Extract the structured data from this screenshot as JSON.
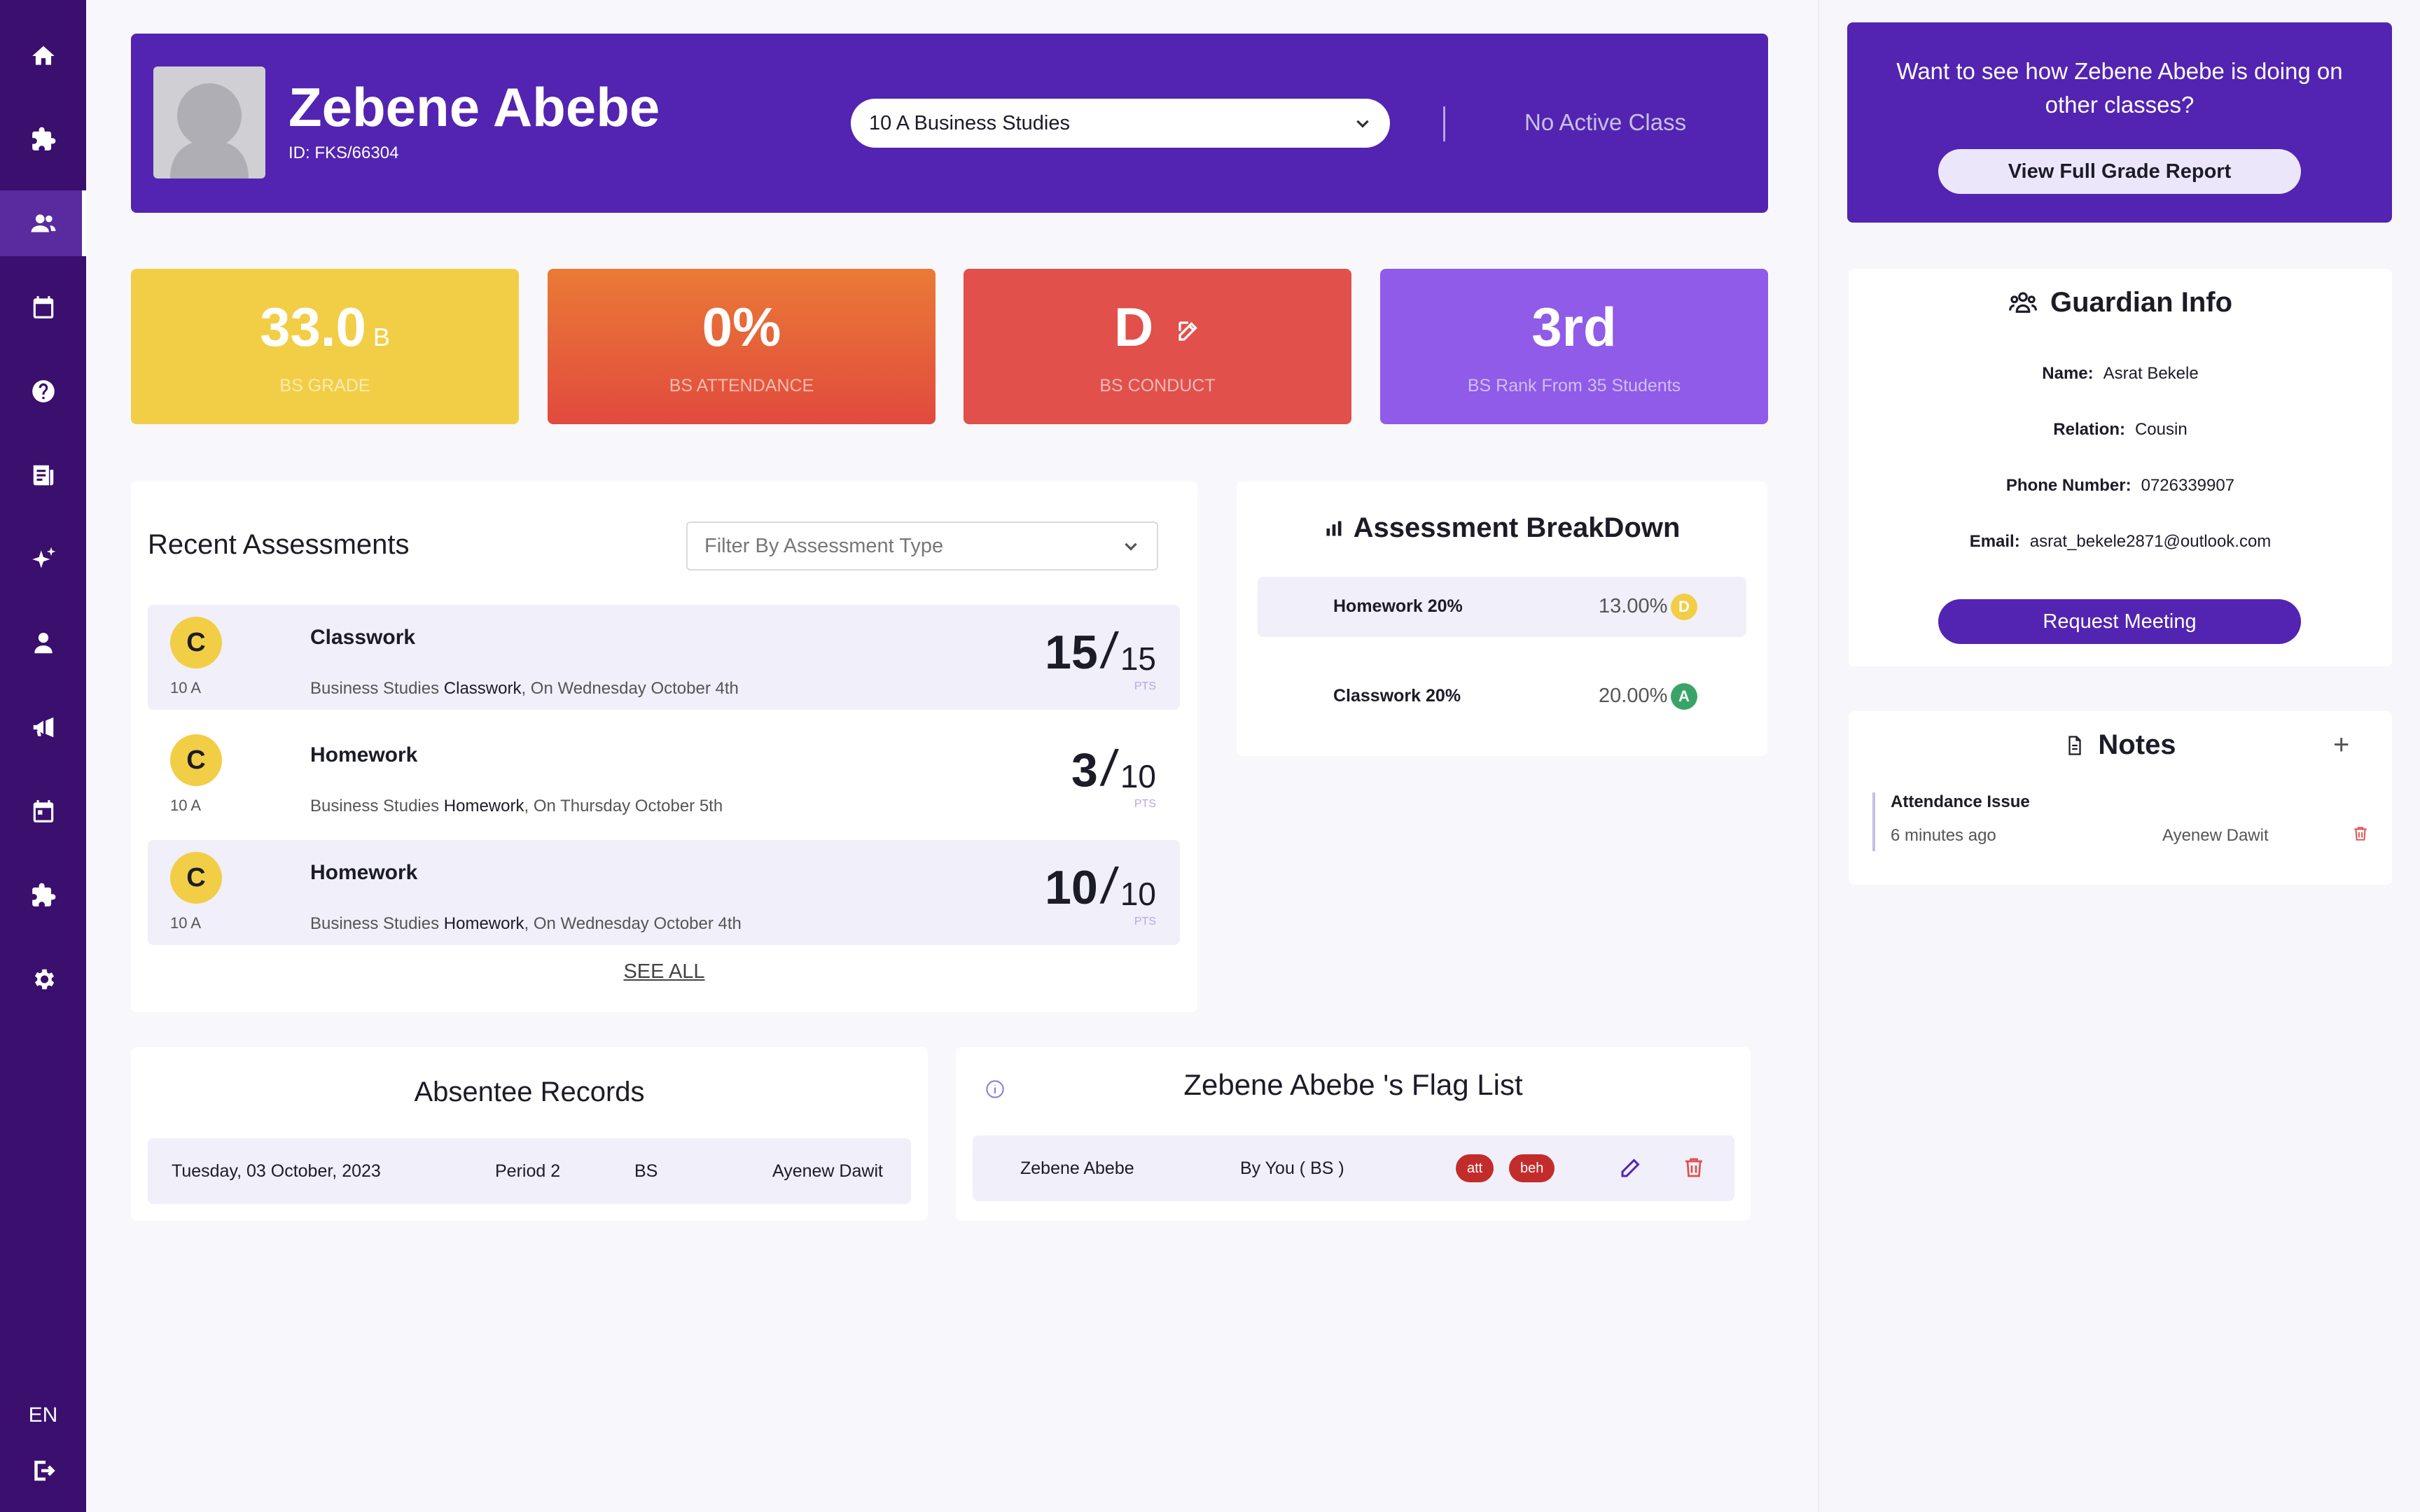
{
  "sidebar": {
    "items": [
      {
        "icon": "home-icon"
      },
      {
        "icon": "puzzle-icon"
      },
      {
        "icon": "users-icon",
        "active": true
      },
      {
        "icon": "calendar-icon"
      },
      {
        "icon": "help-icon"
      },
      {
        "icon": "news-icon"
      },
      {
        "icon": "sparkle-icon"
      },
      {
        "icon": "person-icon"
      },
      {
        "icon": "megaphone-icon"
      },
      {
        "icon": "schedule-icon"
      },
      {
        "icon": "puzzle-icon"
      },
      {
        "icon": "gear-icon"
      }
    ],
    "language": "EN"
  },
  "header": {
    "name": "Zebene Abebe",
    "id": "ID: FKS/66304",
    "class_selected": "10 A Business Studies",
    "no_active_class": "No Active Class"
  },
  "stats": {
    "grade": {
      "value": "33.0",
      "letter": "B",
      "label": "BS GRADE"
    },
    "attendance": {
      "value": "0%",
      "label": "BS ATTENDANCE"
    },
    "conduct": {
      "value": "D",
      "label": "BS CONDUCT"
    },
    "rank": {
      "value": "3rd",
      "label": "BS Rank From 35 Students"
    }
  },
  "recent": {
    "title": "Recent Assessments",
    "filter_placeholder": "Filter By Assessment Type",
    "see_all": "SEE ALL",
    "items": [
      {
        "grade": "C",
        "cls": "10 A",
        "name": "Classwork",
        "subject": "Business Studies",
        "type": "Classwork",
        "date": ",  On Wednesday October 4th",
        "got": "15",
        "of": "15",
        "pts": "PTS"
      },
      {
        "grade": "C",
        "cls": "10 A",
        "name": "Homework",
        "subject": "Business Studies",
        "type": "Homework",
        "date": ",  On Thursday October 5th",
        "got": "3",
        "of": "10",
        "pts": "PTS"
      },
      {
        "grade": "C",
        "cls": "10 A",
        "name": "Homework",
        "subject": "Business Studies",
        "type": "Homework",
        "date": ",  On Wednesday October 4th",
        "got": "10",
        "of": "10",
        "pts": "PTS"
      }
    ]
  },
  "breakdown": {
    "title": "Assessment BreakDown",
    "rows": [
      {
        "name": "Homework 20%",
        "percent": "13.00%",
        "grade": "D",
        "color": "#f2ce46"
      },
      {
        "name": "Classwork 20%",
        "percent": "20.00%",
        "grade": "A",
        "color": "#3aa468"
      }
    ]
  },
  "absentee": {
    "title": "Absentee Records",
    "row": {
      "date": "Tuesday, 03 October, 2023",
      "period": "Period 2",
      "subject": "BS",
      "teacher": "Ayenew Dawit"
    }
  },
  "flags": {
    "title": "Zebene Abebe 's Flag List",
    "row": {
      "student": "Zebene Abebe",
      "by": "By You ( BS )",
      "tags": [
        "att",
        "beh"
      ]
    }
  },
  "promo": {
    "question": "Want to see how Zebene Abebe is doing on other classes?",
    "button": "View Full Grade Report"
  },
  "guardian": {
    "title": "Guardian Info",
    "name_label": "Name:",
    "name": "Asrat Bekele",
    "relation_label": "Relation:",
    "relation": "Cousin",
    "phone_label": "Phone Number:",
    "phone": "0726339907",
    "email_label": "Email:",
    "email": "asrat_bekele2871@outlook.com",
    "button": "Request Meeting"
  },
  "notes": {
    "title": "Notes",
    "add": "+",
    "items": [
      {
        "title": "Attendance Issue",
        "time": "6 minutes ago",
        "author": "Ayenew Dawit"
      }
    ]
  },
  "colors": {
    "brand": "#5224b1",
    "sidebar": "#3a0f6e"
  }
}
